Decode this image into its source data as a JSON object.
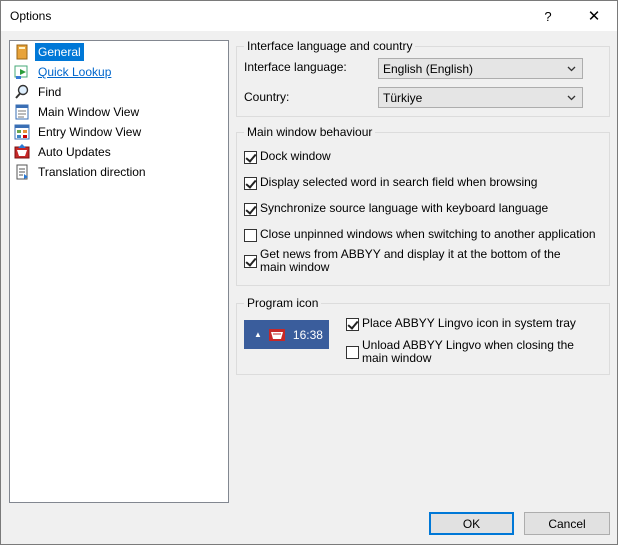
{
  "window": {
    "title": "Options",
    "help_glyph": "?",
    "close_glyph": "✕"
  },
  "tree": [
    {
      "label": "General",
      "icon": "general-icon",
      "selected": true
    },
    {
      "label": "Quick Lookup",
      "icon": "quick-lookup-icon",
      "link": true
    },
    {
      "label": "Find",
      "icon": "find-icon"
    },
    {
      "label": "Main Window View",
      "icon": "main-window-view-icon"
    },
    {
      "label": "Entry Window View",
      "icon": "entry-window-view-icon"
    },
    {
      "label": "Auto Updates",
      "icon": "auto-updates-icon"
    },
    {
      "label": "Translation direction",
      "icon": "translation-direction-icon"
    }
  ],
  "interface_group": {
    "title": "Interface language and country",
    "language_label": "Interface language:",
    "language_value": "English (English)",
    "country_label": "Country:",
    "country_value": "Türkiye"
  },
  "behaviour_group": {
    "title": "Main window behaviour",
    "options": [
      {
        "label": "Dock window",
        "checked": true
      },
      {
        "label": "Display selected word in search field when browsing",
        "checked": true
      },
      {
        "label": "Synchronize source language with keyboard language",
        "checked": true
      },
      {
        "label": "Close unpinned windows when switching to another application",
        "checked": false
      },
      {
        "label": "Get news from ABBYY and display it at the bottom of the main window",
        "checked": true
      }
    ]
  },
  "program_icon_group": {
    "title": "Program icon",
    "tray_time": "16:38",
    "tray_arrow": "▲",
    "options": [
      {
        "label": "Place ABBYY Lingvo icon in system tray",
        "checked": true
      },
      {
        "label": "Unload ABBYY Lingvo when closing the main window",
        "checked": false
      }
    ]
  },
  "buttons": {
    "ok": "OK",
    "cancel": "Cancel"
  },
  "colors": {
    "selection": "#0078d7",
    "tray_bg": "#3a5d9c",
    "link": "#0066cc"
  }
}
